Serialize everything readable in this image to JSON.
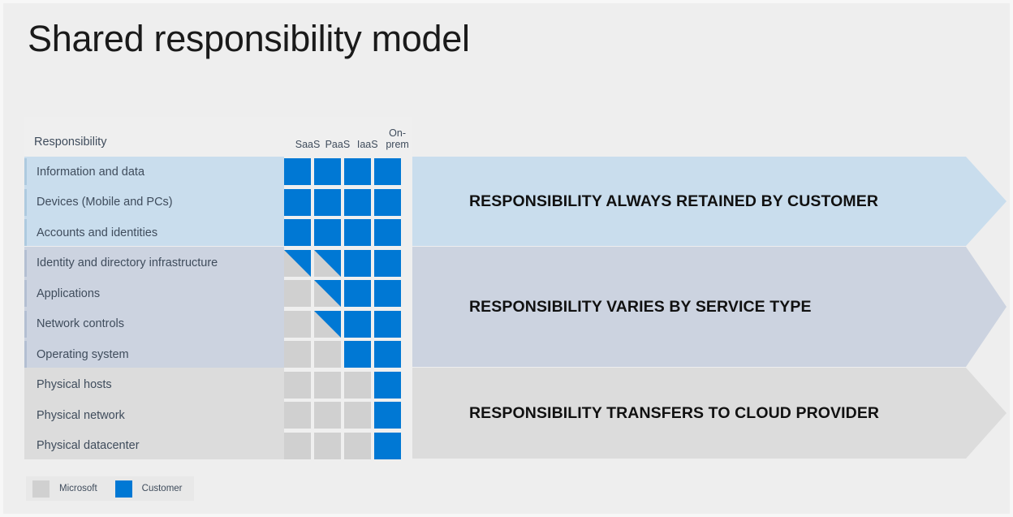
{
  "slide": {
    "title": "Shared responsibility model",
    "background_color": "#eeeeee"
  },
  "colors": {
    "customer": "#0078d4",
    "microsoft": "#d0d0d0",
    "group_always_customer": "#c9dded",
    "group_varies": "#ccd3e0",
    "group_provider": "#dcdcdc",
    "text": "#3f4c5c"
  },
  "table": {
    "headers": {
      "responsibility": "Responsibility",
      "columns": [
        {
          "label": "SaaS",
          "line1": "SaaS",
          "line2": ""
        },
        {
          "label": "PaaS",
          "line1": "PaaS",
          "line2": ""
        },
        {
          "label": "IaaS",
          "line1": "IaaS",
          "line2": ""
        },
        {
          "label": "On-prem",
          "line1": "On-",
          "line2": "prem"
        }
      ]
    },
    "rows": [
      {
        "label": "Information and data",
        "group": "always-customer",
        "cells": [
          "customer",
          "customer",
          "customer",
          "customer"
        ]
      },
      {
        "label": "Devices (Mobile and PCs)",
        "group": "always-customer",
        "cells": [
          "customer",
          "customer",
          "customer",
          "customer"
        ]
      },
      {
        "label": "Accounts and identities",
        "group": "always-customer",
        "cells": [
          "customer",
          "customer",
          "customer",
          "customer"
        ]
      },
      {
        "label": "Identity and directory infrastructure",
        "group": "varies",
        "cells": [
          "split",
          "split",
          "customer",
          "customer"
        ]
      },
      {
        "label": "Applications",
        "group": "varies",
        "cells": [
          "microsoft",
          "split",
          "customer",
          "customer"
        ]
      },
      {
        "label": "Network controls",
        "group": "varies",
        "cells": [
          "microsoft",
          "split",
          "customer",
          "customer"
        ]
      },
      {
        "label": "Operating system",
        "group": "varies",
        "cells": [
          "microsoft",
          "microsoft",
          "customer",
          "customer"
        ]
      },
      {
        "label": "Physical hosts",
        "group": "provider",
        "cells": [
          "microsoft",
          "microsoft",
          "microsoft",
          "customer"
        ]
      },
      {
        "label": "Physical network",
        "group": "provider",
        "cells": [
          "microsoft",
          "microsoft",
          "microsoft",
          "customer"
        ]
      },
      {
        "label": "Physical datacenter",
        "group": "provider",
        "cells": [
          "microsoft",
          "microsoft",
          "microsoft",
          "customer"
        ]
      }
    ]
  },
  "banners": [
    {
      "id": "always-customer",
      "text": "RESPONSIBILITY ALWAYS RETAINED BY CUSTOMER",
      "color": "#c9dded"
    },
    {
      "id": "varies",
      "text": "RESPONSIBILITY VARIES BY SERVICE TYPE",
      "color": "#ccd3e0"
    },
    {
      "id": "provider",
      "text": "RESPONSIBILITY TRANSFERS TO CLOUD PROVIDER",
      "color": "#dcdcdc"
    }
  ],
  "legend": [
    {
      "label": "Microsoft",
      "color": "#d0d0d0",
      "swatch": "microsoft"
    },
    {
      "label": "Customer",
      "color": "#0078d4",
      "swatch": "customer"
    }
  ]
}
